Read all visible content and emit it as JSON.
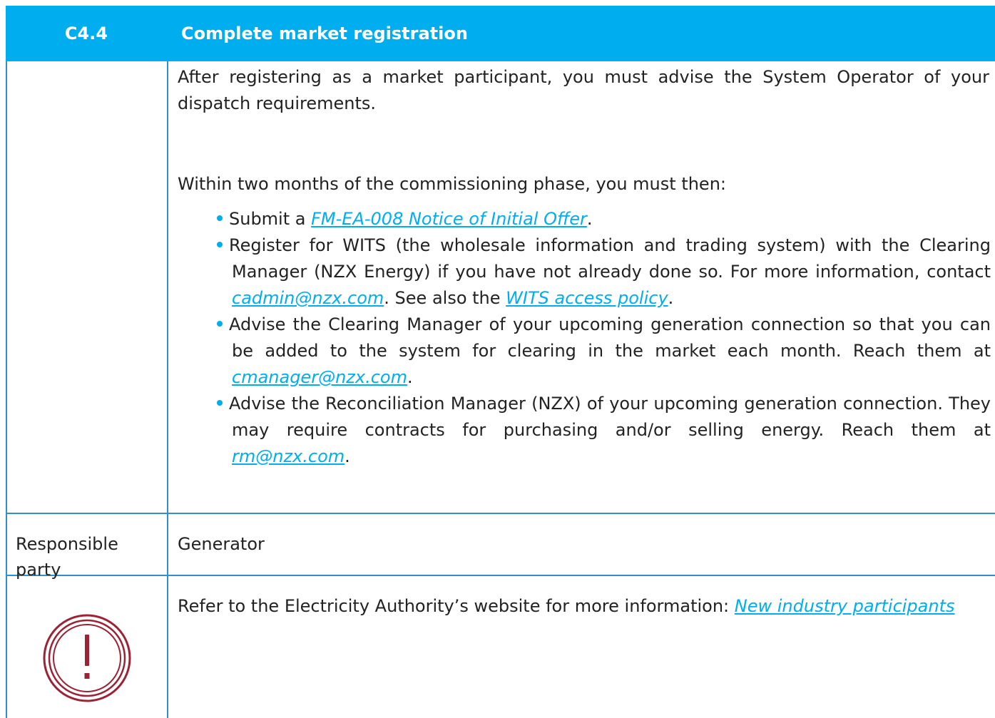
{
  "header": {
    "code": "C4.4",
    "title": "Complete market registration"
  },
  "intro": "After registering as a market participant, you must advise the System Operator of your dispatch requirements.",
  "within": "Within two months of the commissioning phase, you must then:",
  "bullets": {
    "b1": {
      "pre": "Submit a ",
      "link": "FM-EA-008 Notice of Initial Offer",
      "post": "."
    },
    "b2": {
      "pre": "Register for WITS (the wholesale information and trading system) with the Clearing Manager (NZX Energy) if you have not already done so. For more information, contact ",
      "link1": "cadmin@nzx.com",
      "mid": ". See also the ",
      "link2": "WITS access policy",
      "post": "."
    },
    "b3": {
      "pre": "Advise the Clearing Manager of your upcoming generation connection so that you can be added to the system for clearing in the market each month. Reach them at ",
      "link": "cmanager@nzx.com",
      "post": "."
    },
    "b4": {
      "pre": "Advise the Reconciliation Manager (NZX) of your upcoming generation connection. They may require contracts for purchasing and/or selling energy. Reach them at ",
      "link": "rm@nzx.com",
      "post": "."
    }
  },
  "responsible": {
    "label": "Responsible party",
    "value": "Generator"
  },
  "note": {
    "text": "Refer to the Electricity Authority’s website for more information: ",
    "link": "New industry participants"
  },
  "icons": {
    "alert": "exclamation-circle-icon",
    "alert_color": "#9b2335"
  },
  "colors": {
    "accent": "#00aeef",
    "border": "#2f8fd0"
  }
}
